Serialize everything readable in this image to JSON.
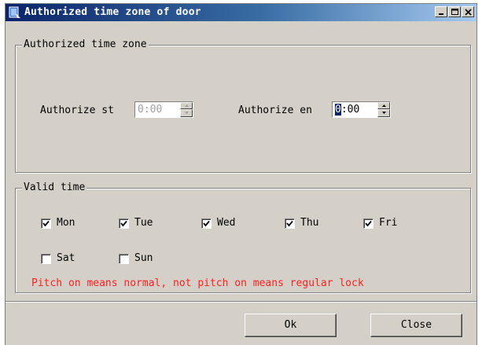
{
  "window": {
    "title": "Authorized time zone of door",
    "icon": "door-app-icon",
    "caption_buttons": [
      "minimize",
      "maximize",
      "close"
    ]
  },
  "zone_group": {
    "legend": "Authorized time zone",
    "start_label": "Authorize st",
    "start_value": "0:00",
    "start_enabled": false,
    "end_label": "Authorize en",
    "end_value_selected": "0",
    "end_value_rest": ":00",
    "end_enabled": true
  },
  "valid_group": {
    "legend": "Valid time",
    "days": [
      {
        "label": "Mon",
        "checked": true
      },
      {
        "label": "Tue",
        "checked": true
      },
      {
        "label": "Wed",
        "checked": true
      },
      {
        "label": "Thu",
        "checked": true
      },
      {
        "label": "Fri",
        "checked": true
      },
      {
        "label": "Sat",
        "checked": false
      },
      {
        "label": "Sun",
        "checked": false
      }
    ],
    "note": "Pitch on means normal, not pitch on means regular lock",
    "note_color": "#ff2020"
  },
  "buttons": {
    "ok": "Ok",
    "close": "Close"
  }
}
